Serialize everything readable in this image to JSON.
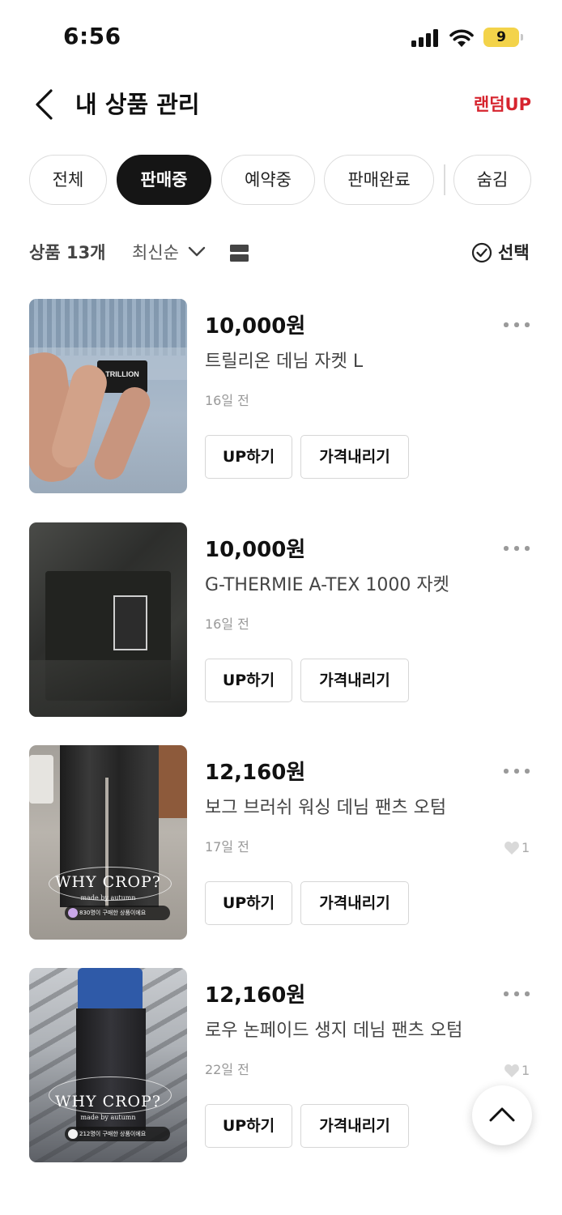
{
  "status_bar": {
    "time": "6:56",
    "battery": "9"
  },
  "header": {
    "title": "내 상품 관리",
    "random_up": "랜덤UP"
  },
  "filters": [
    {
      "label": "전체",
      "active": false
    },
    {
      "label": "판매중",
      "active": true
    },
    {
      "label": "예약중",
      "active": false
    },
    {
      "label": "판매완료",
      "active": false
    },
    {
      "label": "숨김",
      "active": false
    }
  ],
  "toolbar": {
    "count": "상품 13개",
    "sort": "최신순",
    "select": "선택"
  },
  "products": [
    {
      "price": "10,000원",
      "name": "트릴리온 데님 자켓 L",
      "time": "16일 전",
      "likes": null,
      "up_label": "UP하기",
      "price_down_label": "가격내리기",
      "thumb_label": "TRILLION"
    },
    {
      "price": "10,000원",
      "name": "G-THERMIE A-TEX 1000 자켓",
      "time": "16일 전",
      "likes": null,
      "up_label": "UP하기",
      "price_down_label": "가격내리기"
    },
    {
      "price": "12,160원",
      "name": "보그 브러쉬 워싱 데님 팬츠 오텀",
      "time": "17일 전",
      "likes": "1",
      "up_label": "UP하기",
      "price_down_label": "가격내리기",
      "thumb_label": "WHY CROP?",
      "thumb_sub": "made by autumn",
      "thumb_badge": "830명이 구매한 상품이에요"
    },
    {
      "price": "12,160원",
      "name": "로우 논페이드 생지 데님 팬츠 오텀",
      "time": "22일 전",
      "likes": "1",
      "up_label": "UP하기",
      "price_down_label": "가격내리기",
      "thumb_label": "WHY CROP?",
      "thumb_sub": "made by autumn",
      "thumb_badge": "212명이 구매한 상품이에요"
    }
  ],
  "colors": {
    "accent": "#d6242e",
    "chip_active": "#151515"
  }
}
